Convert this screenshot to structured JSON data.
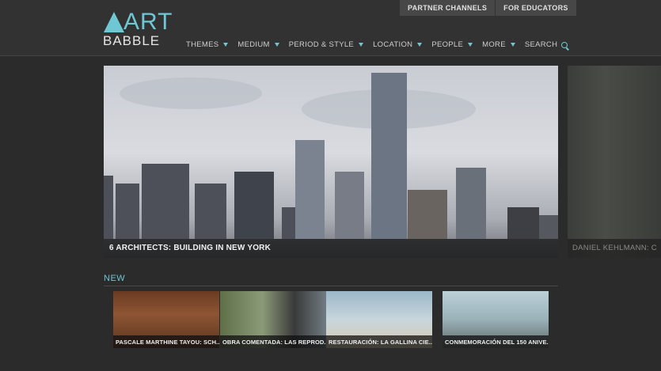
{
  "header": {
    "logo_art": "ART",
    "logo_babble": "BABBLE",
    "top_links": [
      "PARTNER CHANNELS",
      "FOR EDUCATORS"
    ],
    "nav": [
      "THEMES",
      "MEDIUM",
      "PERIOD & STYLE",
      "LOCATION",
      "PEOPLE",
      "MORE"
    ],
    "search_label": "SEARCH"
  },
  "hero": {
    "caption": "6 ARCHITECTS: BUILDING IN NEW YORK",
    "next_caption": "DANIEL KEHLMANN: C"
  },
  "new_section": {
    "label": "NEW",
    "items": [
      "PASCALE MARTHINE TAYOU: SCH...",
      "OBRA COMENTADA: LAS REPROD...",
      "RESTAURACIÓN: LA GALLINA CIE...",
      "CONMEMORACIÓN DEL 150 ANIVE..."
    ]
  },
  "colors": {
    "accent": "#6fc7d3",
    "background": "#2b2b2b",
    "header": "#323232"
  },
  "icons": [
    "search-icon",
    "chevron-down-icon"
  ]
}
